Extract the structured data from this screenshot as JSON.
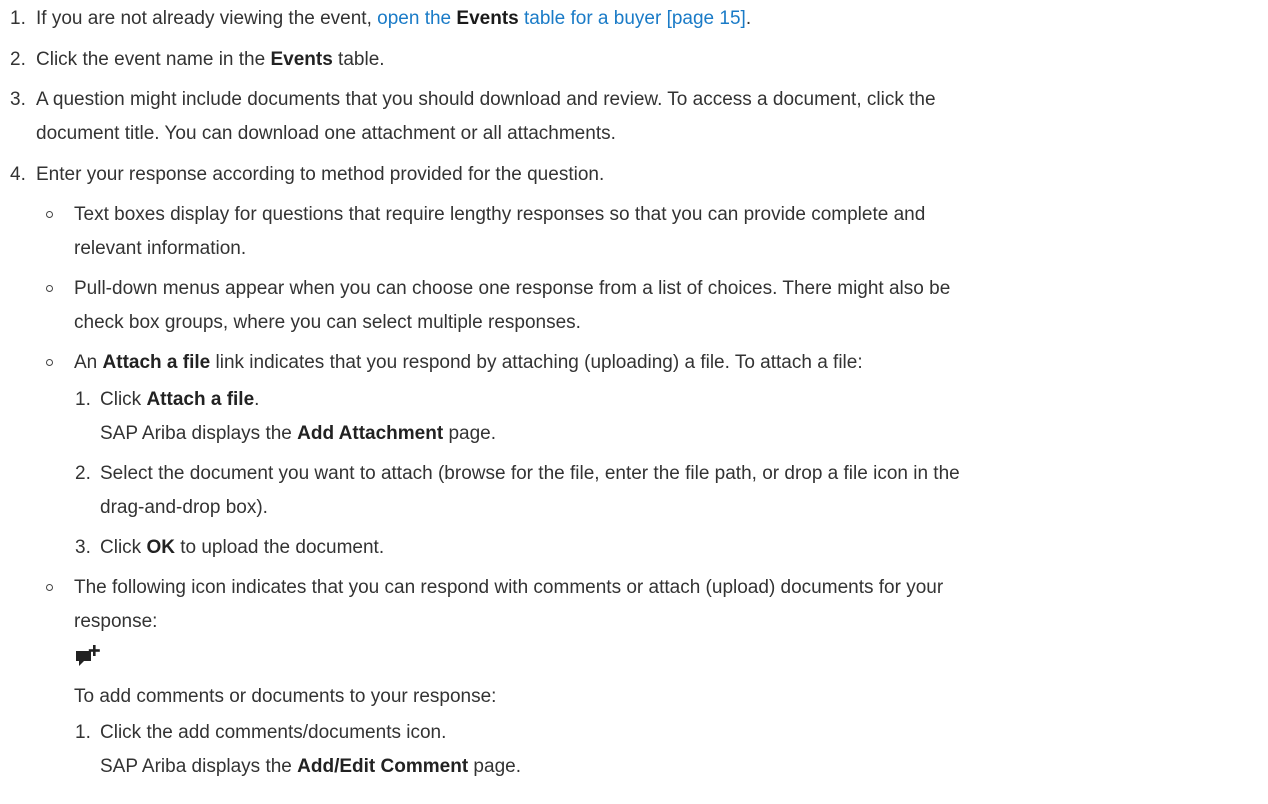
{
  "steps": {
    "s1": {
      "num": "1.",
      "pre": "If you are not already viewing the event, ",
      "link_a": "open the ",
      "link_b": "Events",
      "link_c": " table for a buyer [page 15]",
      "post": "."
    },
    "s2": {
      "num": "2.",
      "pre": "Click the event name in the ",
      "bold": "Events",
      "post": " table."
    },
    "s3": {
      "num": "3.",
      "line1": "A question might include documents that you should download and review. To access a document, click the",
      "line2": "document title. You can download one attachment or all attachments."
    },
    "s4": {
      "num": "4.",
      "text": "Enter your response according to method provided for the question."
    }
  },
  "bullets": {
    "b1": {
      "line1": "Text boxes display for questions that require lengthy responses so that you can provide complete and",
      "line2": "relevant information."
    },
    "b2": {
      "line1": "Pull-down menus appear when you can choose one response from a list of choices. There might also be",
      "line2": "check box groups, where you can select multiple responses."
    },
    "b3": {
      "pre": "An ",
      "bold": "Attach a file",
      "post": " link indicates that you respond by attaching (uploading) a file. To attach a file:"
    },
    "b4": {
      "line1": "The following icon indicates that you can respond with comments or attach (upload) documents for your",
      "line2": "response:",
      "icon": "add-comment-icon",
      "after": "To add comments or documents to your response:"
    }
  },
  "attach_steps": {
    "a1": {
      "num": "1.",
      "pre": "Click ",
      "bold": "Attach a file",
      "post": ".",
      "l2_pre": "SAP Ariba displays the ",
      "l2_bold": "Add Attachment",
      "l2_post": " page."
    },
    "a2": {
      "num": "2.",
      "line1": "Select the document you want to attach (browse for the file, enter the file path, or drop a file icon in the",
      "line2": "drag-and-drop box)."
    },
    "a3": {
      "num": "3.",
      "pre": "Click ",
      "bold": "OK",
      "post": " to upload the document."
    }
  },
  "comment_steps": {
    "c1": {
      "num": "1.",
      "text": "Click the add comments/documents icon.",
      "l2_pre": "SAP Ariba displays the ",
      "l2_bold": "Add/Edit Comment",
      "l2_post": " page."
    }
  },
  "colors": {
    "text": "#333333",
    "link": "#1a7bc7"
  }
}
